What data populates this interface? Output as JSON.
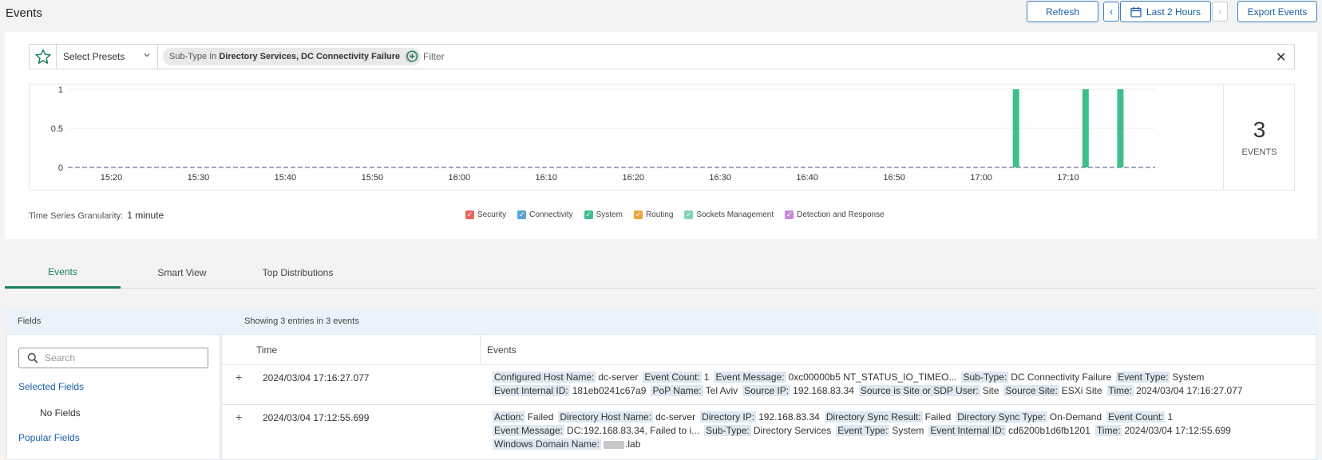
{
  "page": {
    "title": "Events"
  },
  "toolbar": {
    "refresh": "Refresh",
    "time_range": "Last 2 Hours",
    "export": "Export Events"
  },
  "filter": {
    "presets_label": "Select Presets",
    "chip_prefix": "Sub-Type In",
    "chip_value": "Directory Services, DC Connectivity Failure",
    "add_filter": "Filter"
  },
  "chart_data": {
    "type": "bar",
    "x_tick_labels": [
      "15:20",
      "15:30",
      "15:40",
      "15:50",
      "16:00",
      "16:10",
      "16:20",
      "16:30",
      "16:40",
      "16:50",
      "17:00",
      "17:10"
    ],
    "y_tick_labels": [
      "1",
      "0.5",
      "0"
    ],
    "ylim": [
      0,
      1
    ],
    "bars": [
      {
        "time": "17:04",
        "value": 1
      },
      {
        "time": "17:12",
        "value": 1
      },
      {
        "time": "17:16",
        "value": 1
      }
    ],
    "bar_color": "#3dbf8c",
    "total": "3",
    "total_label": "EVENTS"
  },
  "granularity": {
    "label": "Time Series Granularity:",
    "value": "1 minute"
  },
  "legend": [
    {
      "name": "Security",
      "color": "#e8675e"
    },
    {
      "name": "Connectivity",
      "color": "#5aa3d8"
    },
    {
      "name": "System",
      "color": "#3dbf8c"
    },
    {
      "name": "Routing",
      "color": "#f0a23b"
    },
    {
      "name": "Sockets Management",
      "color": "#7fd1b2"
    },
    {
      "name": "Detection and Response",
      "color": "#c889d6"
    }
  ],
  "tabs": [
    {
      "label": "Events",
      "active": true
    },
    {
      "label": "Smart View",
      "active": false
    },
    {
      "label": "Top Distributions",
      "active": false
    }
  ],
  "fields": {
    "header": "Fields",
    "search_placeholder": "Search",
    "selected": "Selected Fields",
    "no_fields": "No Fields",
    "popular": "Popular Fields"
  },
  "table": {
    "info": "Showing 3 entries in 3 events",
    "col_time": "Time",
    "col_events": "Events",
    "rows": [
      {
        "time": "2024/03/04 17:16:27.077",
        "lines": [
          [
            {
              "k": "Configured Host Name:",
              "v": "dc-server"
            },
            {
              "k": "Event Count:",
              "v": "1"
            },
            {
              "k": "Event Message:",
              "v": "0xc00000b5 NT_STATUS_IO_TIMEO..."
            },
            {
              "k": "Sub-Type:",
              "v": "DC Connectivity Failure"
            },
            {
              "k": "Event Type:",
              "v": "System"
            }
          ],
          [
            {
              "k": "Event Internal ID:",
              "v": "181eb0241c67a9"
            },
            {
              "k": "PoP Name:",
              "v": "Tel Aviv"
            },
            {
              "k": "Source IP:",
              "v": "192.168.83.34"
            },
            {
              "k": "Source is Site or SDP User:",
              "v": "Site"
            },
            {
              "k": "Source Site:",
              "v": "ESXi Site"
            },
            {
              "k": "Time:",
              "v": "2024/03/04 17:16:27.077"
            }
          ]
        ]
      },
      {
        "time": "2024/03/04 17:12:55.699",
        "lines": [
          [
            {
              "k": "Action:",
              "v": "Failed"
            },
            {
              "k": "Directory Host Name:",
              "v": "dc-server"
            },
            {
              "k": "Directory IP:",
              "v": "192.168.83.34"
            },
            {
              "k": "Directory Sync Result:",
              "v": "Failed"
            },
            {
              "k": "Directory Sync Type:",
              "v": "On-Demand"
            },
            {
              "k": "Event Count:",
              "v": "1"
            }
          ],
          [
            {
              "k": "Event Message:",
              "v": "DC:192.168.83.34, Failed to i..."
            },
            {
              "k": "Sub-Type:",
              "v": "Directory Services"
            },
            {
              "k": "Event Type:",
              "v": "System"
            },
            {
              "k": "Event Internal ID:",
              "v": "cd6200b1d6fb1201"
            },
            {
              "k": "Time:",
              "v": "2024/03/04 17:12:55.699"
            }
          ],
          [
            {
              "k": "Windows Domain Name:",
              "v": ".lab",
              "redacted": true
            }
          ]
        ]
      }
    ]
  }
}
